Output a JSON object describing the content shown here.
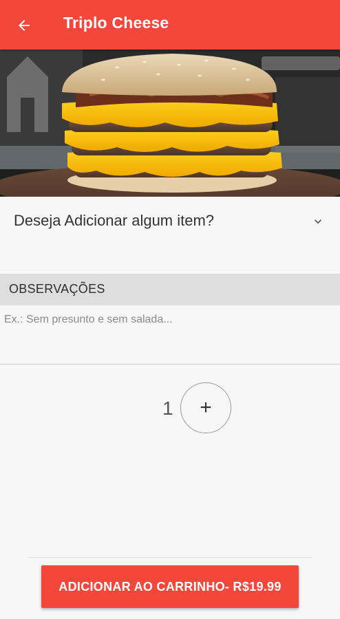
{
  "app_bar": {
    "title": "Triplo Cheese",
    "back_icon": "arrow-left-icon",
    "color": "#f2473a"
  },
  "hero_image": {
    "icon": "burger-photo"
  },
  "addons": {
    "label": "Deseja Adicionar algum item?",
    "icon": "chevron-down-icon"
  },
  "observations": {
    "header": "OBSERVAÇÕES",
    "placeholder": "Ex.: Sem presunto e sem salada...",
    "value": ""
  },
  "quantity": {
    "value": "1",
    "increment_label": "+"
  },
  "cart_button": {
    "label": "ADICIONAR AO CARRINHO- R$19.99",
    "color": "#f2473a"
  }
}
